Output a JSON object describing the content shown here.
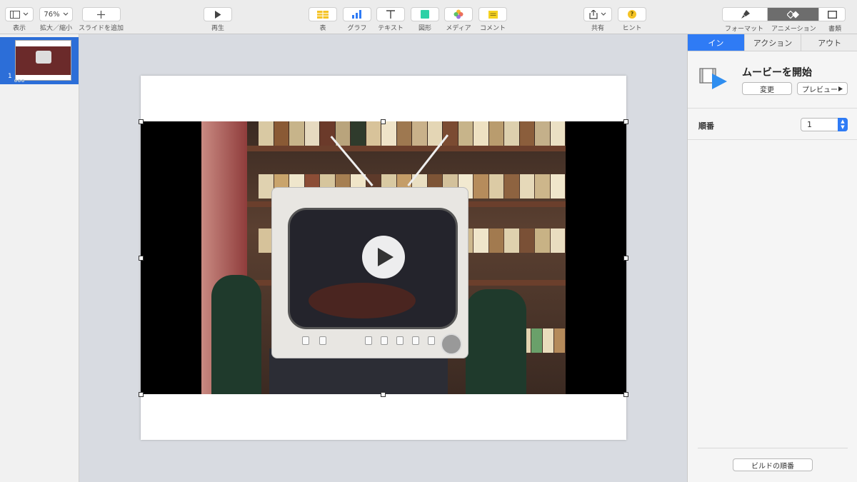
{
  "toolbar": {
    "view_label": "表示",
    "zoom_value": "76%",
    "zoom_label": "拡大／縮小",
    "add_slide_label": "スライドを追加",
    "play_label": "再生",
    "table_label": "表",
    "chart_label": "グラフ",
    "text_label": "テキスト",
    "shape_label": "図形",
    "media_label": "メディア",
    "comment_label": "コメント",
    "share_label": "共有",
    "tips_label": "ヒント",
    "format_label": "フォーマット",
    "animate_label": "アニメーション",
    "document_label": "書類",
    "tips_icon_glyph": "?"
  },
  "navigator": {
    "slide_number": "1"
  },
  "inspector": {
    "tabs": [
      "イン",
      "アクション",
      "アウト"
    ],
    "active_tab": "イン",
    "animation_title": "ムービーを開始",
    "change_button": "変更",
    "preview_button": "プレビュー",
    "order_label": "順番",
    "order_value": "1",
    "build_order_button": "ビルドの順番"
  },
  "colors": {
    "accent": "#2f7bf5",
    "canvas": "#d8dbe1",
    "toolbar": "#ececec"
  }
}
